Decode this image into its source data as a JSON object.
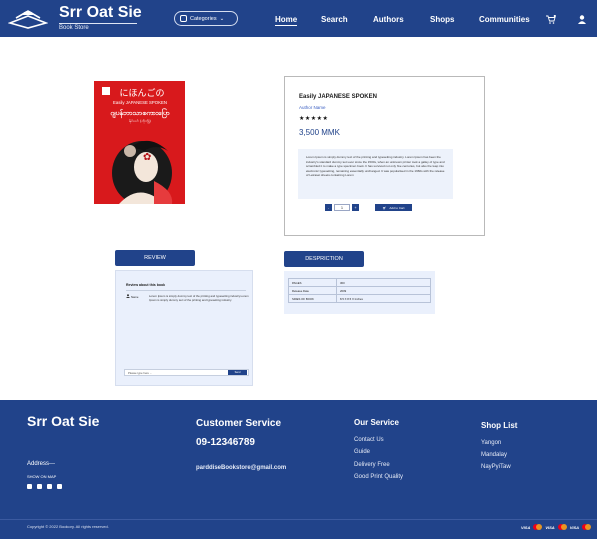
{
  "header": {
    "brand": "Srr Oat Sie",
    "brand_sub": "Book Store",
    "categories_label": "Categories",
    "nav": [
      "Home",
      "Search",
      "Authors",
      "Shops",
      "Communities"
    ],
    "active_nav": "Home",
    "icons": [
      "books-logo-icon",
      "grid-icon",
      "chevron-down-icon",
      "cart-icon",
      "user-icon"
    ]
  },
  "book": {
    "cover_lines": [
      "にほんごの",
      "Easily JAPANESE SPOKEN",
      "ဂျပန်ဘာသာစကားပြော",
      "နိုင်လင်း (တိုကျို)"
    ],
    "cover_color": "#d8191c",
    "title": "Easily JAPANESE SPOKEN",
    "author_label": "Author Name",
    "stars": "★★★★★",
    "rating": 5,
    "price": "3,500 MMK",
    "description": "Lorem Ipsum is simply dummy text of the printing and typesetting industry. Lorem Ipsum has been the industry's standard dummy text ever since the 1500s, when an unknown printer took a galley of type and scrambled it to make a type specimen book. It has survived not only five centuries, but also the leap into electronic typesetting, remaining essentially unchanged. It was popularised in the 1960s with the release of Letraset sheets containing Lorem",
    "quantity": "1",
    "minus": "-",
    "plus": "+",
    "add_to_cart": "Add to Cart"
  },
  "tabs": {
    "review": "REVIEW",
    "description": "DESPRICTION"
  },
  "review": {
    "heading": "Review about this book",
    "reviewer": "Name",
    "text": "Lorem Ipsum is simply dummy text of the printing and typesetting industry.Lorem Ipsum is simply dummy text of the printing and typesetting industry.",
    "input_placeholder": "Please type here ...",
    "send_label": "Send"
  },
  "specs": [
    {
      "label": "PAGES",
      "value": "300"
    },
    {
      "label": "Release Date",
      "value": "2009"
    },
    {
      "label": "SIDES OF BOOK",
      "value": "8.5 X 8.5 X Inches"
    }
  ],
  "footer": {
    "brand": "Srr Oat Sie",
    "address": "Address---",
    "show_map": "SHOW ON MAP",
    "customer_service_title": "Customer Service",
    "phone": "09-12346789",
    "email": "parddiseBookstore@gmail.com",
    "our_service_title": "Our Service",
    "services": [
      "Contact Us",
      "Guide",
      "Delivery Free",
      "Good Print Quality"
    ],
    "shop_list_title": "Shop List",
    "shops": [
      "Yangon",
      "Mandalay",
      "NayPyiTaw"
    ],
    "copyright": "Copyright © 2022 Bookory. All rights reserved.",
    "payments": [
      "VISA",
      "mastercard",
      "VISA",
      "mastercard",
      "VISA",
      "mastercard"
    ]
  },
  "colors": {
    "brand_blue": "#21438a",
    "panel_bg": "#eaf0fc",
    "book_red": "#d8191c"
  }
}
